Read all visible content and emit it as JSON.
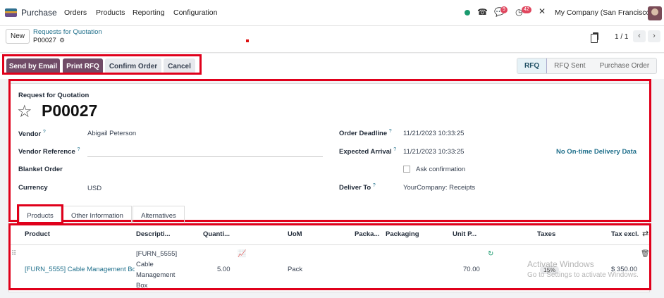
{
  "nav": {
    "app_name": "Purchase",
    "menu": [
      "Orders",
      "Products",
      "Reporting",
      "Configuration"
    ],
    "activity_count": "9",
    "clock_count": "42",
    "company": "My Company (San Francisco)"
  },
  "control": {
    "new_label": "New",
    "breadcrumb_parent": "Requests for Quotation",
    "breadcrumb_current": "P00027",
    "pager": "1 / 1"
  },
  "actions": {
    "send_email": "Send by Email",
    "print_rfq": "Print RFQ",
    "confirm": "Confirm Order",
    "cancel": "Cancel"
  },
  "status": {
    "steps": [
      "RFQ",
      "RFQ Sent",
      "Purchase Order"
    ],
    "active": "RFQ"
  },
  "form": {
    "doc_type": "Request for Quotation",
    "name": "P00027",
    "vendor_label": "Vendor",
    "vendor": "Abigail Peterson",
    "vendor_ref_label": "Vendor Reference",
    "blanket_label": "Blanket Order",
    "currency_label": "Currency",
    "currency": "USD",
    "deadline_label": "Order Deadline",
    "deadline": "11/21/2023 10:33:25",
    "expected_label": "Expected Arrival",
    "expected": "11/21/2023 10:33:25",
    "ontime": "No On-time Delivery Data",
    "ask_confirmation": "Ask confirmation",
    "deliver_label": "Deliver To",
    "deliver": "YourCompany: Receipts"
  },
  "tabs": [
    "Products",
    "Other Information",
    "Alternatives"
  ],
  "table": {
    "headers": {
      "product": "Product",
      "description": "Descripti...",
      "quantity": "Quanti...",
      "uom": "UoM",
      "pack_qty": "Packa...",
      "packaging": "Packaging",
      "unit_price": "Unit P...",
      "taxes": "Taxes",
      "tax_excl": "Tax excl."
    },
    "rows": [
      {
        "product": "[FURN_5555] Cable Management Bo",
        "description": [
          "[FURN_5555]",
          "Cable",
          "Management",
          "Box"
        ],
        "quantity": "5.00",
        "uom": "Pack",
        "unit_price": "70.00",
        "tax": "15%",
        "subtotal": "$ 350.00"
      }
    ]
  },
  "watermark": {
    "title": "Activate Windows",
    "subtitle": "Go to Settings to activate Windows."
  },
  "colors": {
    "brand": "#714b67",
    "link": "#1f6f8b",
    "highlight_box": "#e0001b"
  }
}
